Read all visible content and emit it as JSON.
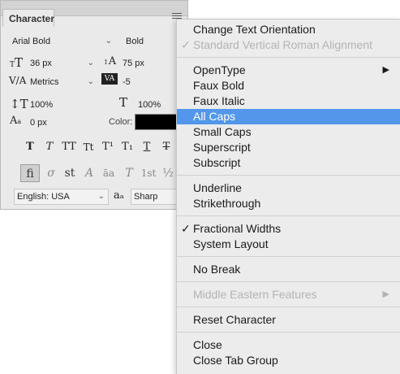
{
  "panel": {
    "tab_label": "Character",
    "font_family": "Arial Bold",
    "font_style": "Bold",
    "font_size": "36 px",
    "leading": "75 px",
    "kerning": "Metrics",
    "tracking": "-5",
    "vertical_scale": "100%",
    "horizontal_scale": "100%",
    "baseline_shift": "0 px",
    "color_label": "Color:",
    "color_value": "#000000",
    "language": "English: USA",
    "antialias_icon_text": "aₐ",
    "antialias": "Sharp",
    "faux_buttons": [
      "T",
      "T",
      "TT",
      "Tt",
      "T¹",
      "T₁",
      "T",
      "T"
    ],
    "opentype_buttons": [
      "fi",
      "σ",
      "st",
      "A",
      "āa",
      "T",
      "1st",
      "½"
    ]
  },
  "menu": {
    "items": [
      {
        "label": "Change Text Orientation",
        "disabled": false,
        "checked": false
      },
      {
        "label": "Standard Vertical Roman Alignment",
        "disabled": true,
        "checked": true
      },
      {
        "label": "OpenType",
        "disabled": false,
        "checked": false,
        "submenu": true
      },
      {
        "label": "Faux Bold",
        "disabled": false,
        "checked": false
      },
      {
        "label": "Faux Italic",
        "disabled": false,
        "checked": false
      },
      {
        "label": "All Caps",
        "disabled": false,
        "checked": false,
        "highlighted": true
      },
      {
        "label": "Small Caps",
        "disabled": false,
        "checked": false
      },
      {
        "label": "Superscript",
        "disabled": false,
        "checked": false
      },
      {
        "label": "Subscript",
        "disabled": false,
        "checked": false
      },
      {
        "label": "Underline",
        "disabled": false,
        "checked": false
      },
      {
        "label": "Strikethrough",
        "disabled": false,
        "checked": false
      },
      {
        "label": "Fractional Widths",
        "disabled": false,
        "checked": true
      },
      {
        "label": "System Layout",
        "disabled": false,
        "checked": false
      },
      {
        "label": "No Break",
        "disabled": false,
        "checked": false
      },
      {
        "label": "Middle Eastern Features",
        "disabled": true,
        "checked": false,
        "submenu": true
      },
      {
        "label": "Reset Character",
        "disabled": false,
        "checked": false
      },
      {
        "label": "Close",
        "disabled": false,
        "checked": false
      },
      {
        "label": "Close Tab Group",
        "disabled": false,
        "checked": false
      }
    ],
    "check_glyph": "✓",
    "submenu_glyph": "▶",
    "highlight_color": "#5297ea"
  }
}
